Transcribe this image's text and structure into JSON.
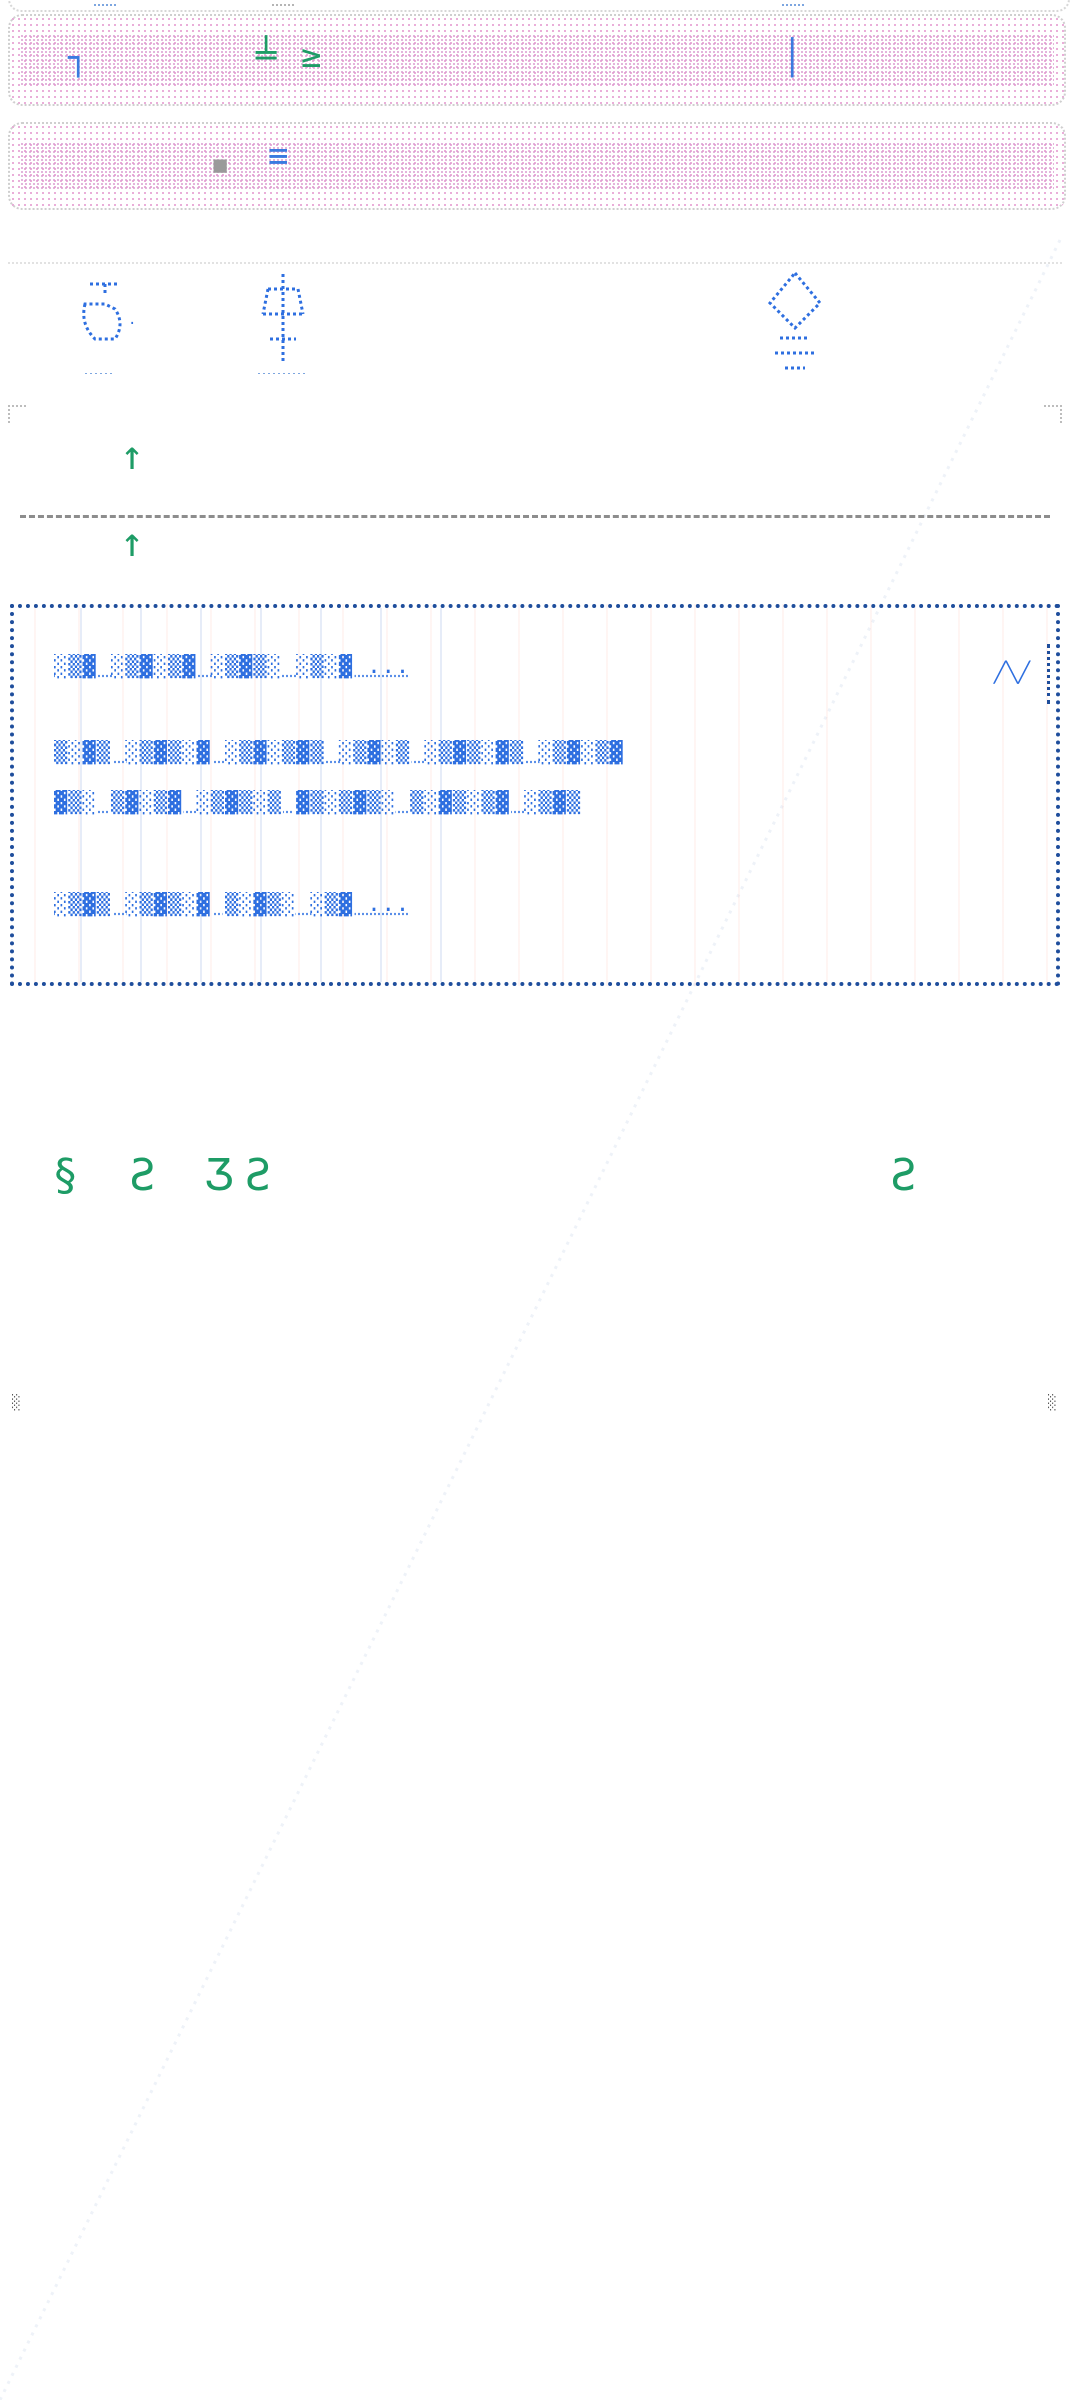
{
  "colors": {
    "accent_blue": "#2e6fe0",
    "accent_green": "#1e9c66",
    "border_dark_blue": "#1f4e9c",
    "pink_dots": "#e8a7d6",
    "grey_border": "#cfcfcf"
  },
  "icons": {
    "tab_left": "tab-left-icon",
    "tab_right": "tab-right-icon",
    "nav_1": "home-icon",
    "nav_2": "tree-icon",
    "nav_3": "diamond-icon",
    "arrow_up": "arrow-up-icon",
    "arrow_up_2": "arrow-up-icon"
  },
  "bar1": {
    "left_glyph": "┐",
    "mid_glyph": "╧ ≥",
    "right_glyph": "│"
  },
  "bar2": {
    "left_glyph": "▪",
    "mid_glyph": "≡"
  },
  "section": {
    "glyph_a": "↑",
    "glyph_b": "↑"
  },
  "notice": {
    "lines": [
      "░▒▓ ░▒▓░▒▓ ░▒▓▒░ ░▒░▓ ...",
      "▒░▓▒ ░▒▓▒░▓ ░▒▓░▒▓▒ ░▒▓░▒ ░▒▓▒░▓▒ ░▒▓░▒▓",
      "▓▒░ ▒▓░▒▓ ░▒▓▒░▒ ▓▒░▒▓▒░ ▒░▓▒░▒▓ ░▒▓▒",
      "░▒▓▒ ░▒▓▒░▓ ▒░▓▒░ ░▒▓ ..."
    ],
    "trail_mark": "╱╲╱"
  },
  "stats": {
    "left": "§ Ƨ ƷƧ",
    "right": "Ƨ"
  },
  "footer": {
    "left_mark": "░",
    "right_mark": "░"
  }
}
